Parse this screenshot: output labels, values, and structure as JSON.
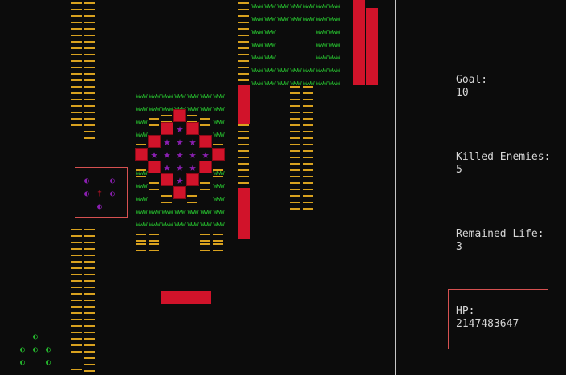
{
  "game": {
    "ladder_color": "#d9a21f",
    "grass_color": "#25b52d",
    "wall_color": "#d1132a",
    "purple_color": "#8a1fb0",
    "grass_glyph": "wwwwwwww",
    "star_glyph": "★",
    "enemy_glyph": "◐",
    "player_glyph": "†"
  },
  "hud": {
    "goal_label": "Goal:",
    "goal_value": "10",
    "killed_label": "Killed Enemies:",
    "killed_value": "5",
    "life_label": "Remained Life:",
    "life_value": "3",
    "hp_label": "HP:",
    "hp_value": "2147483647"
  }
}
